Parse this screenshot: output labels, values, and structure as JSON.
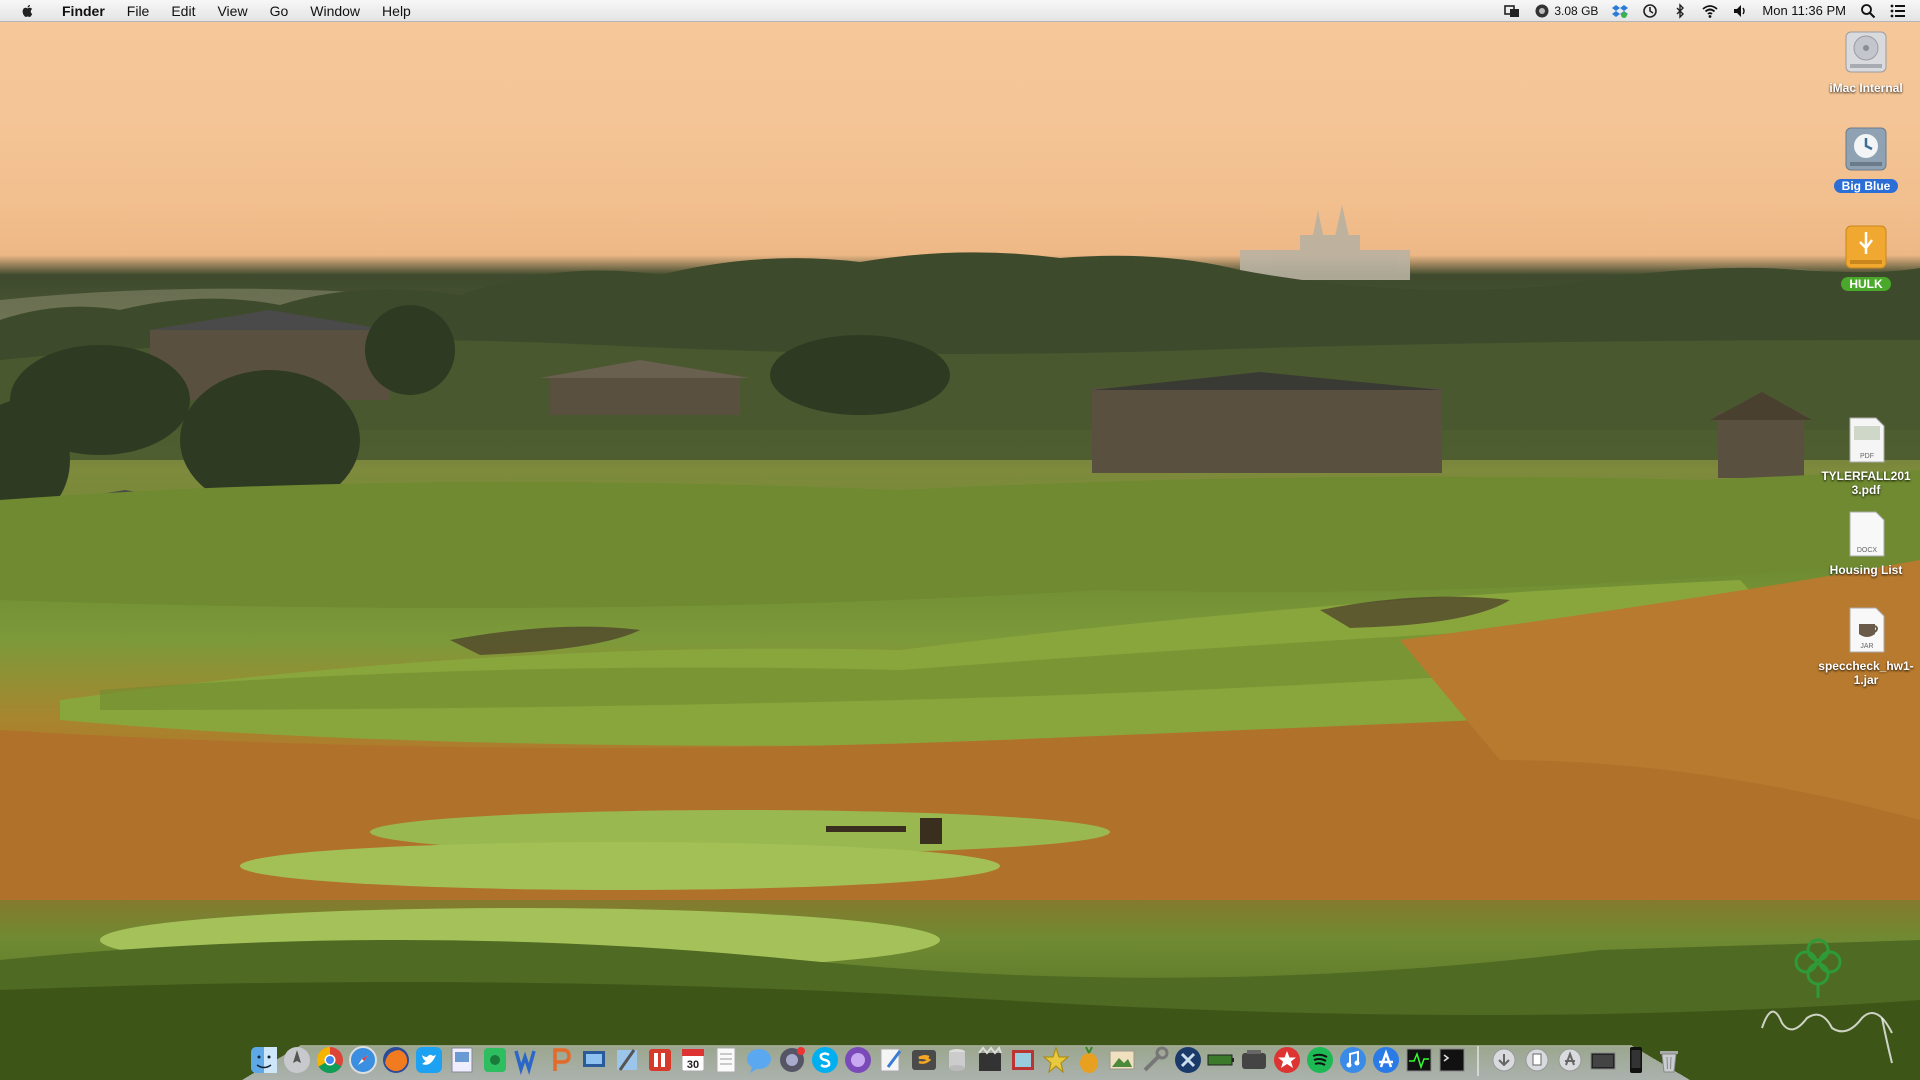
{
  "menubar": {
    "app_name": "Finder",
    "menus": [
      "File",
      "Edit",
      "View",
      "Go",
      "Window",
      "Help"
    ],
    "memory": "3.08 GB",
    "clock": "Mon 11:36 PM"
  },
  "desktop_icons": [
    {
      "name": "iMac Internal",
      "type": "drive"
    },
    {
      "name": "Big Blue",
      "type": "time-machine"
    },
    {
      "name": "HULK",
      "type": "usb-drive"
    },
    {
      "name": "TYLERFALL2013.pdf",
      "type": "pdf",
      "badge": "PDF"
    },
    {
      "name": "Housing List",
      "type": "docx",
      "badge": "DOCX"
    },
    {
      "name": "speccheck_hw1-1.jar",
      "type": "jar",
      "badge": "JAR"
    }
  ],
  "dock_calendar_day": "30",
  "dock_apps": [
    "finder-icon",
    "launchpad-icon",
    "chrome-icon",
    "safari-icon",
    "firefox-icon",
    "twitter-icon",
    "preview-icon",
    "evernote-icon",
    "word-icon",
    "powerpoint-icon",
    "network-icon",
    "xcode-icon",
    "parallels-icon",
    "calendar-icon",
    "notes-icon",
    "messages-icon",
    "facetime-icon",
    "skype-icon",
    "siri-icon",
    "pages-icon",
    "sublime-icon",
    "db-icon",
    "finalcut-icon",
    "photobooth-icon",
    "imovie-icon",
    "fruit-icon",
    "iphoto-icon",
    "tools-icon",
    "mac-x-icon",
    "battery-icon",
    "terminal-tools-icon",
    "star-icon",
    "spotify-icon",
    "itunes-icon",
    "appstore-icon",
    "activity-monitor-icon",
    "terminal-icon"
  ],
  "dock_right": [
    "downloads-stack-icon",
    "documents-stack-icon",
    "applications-stack-icon",
    "desktop-stack-icon",
    "iphone-icon",
    "trash-icon"
  ],
  "colors": {
    "menubar_bg": "#ececec",
    "label_pill_blue": "#2b6fd6",
    "label_pill_green": "#4aa92a"
  }
}
